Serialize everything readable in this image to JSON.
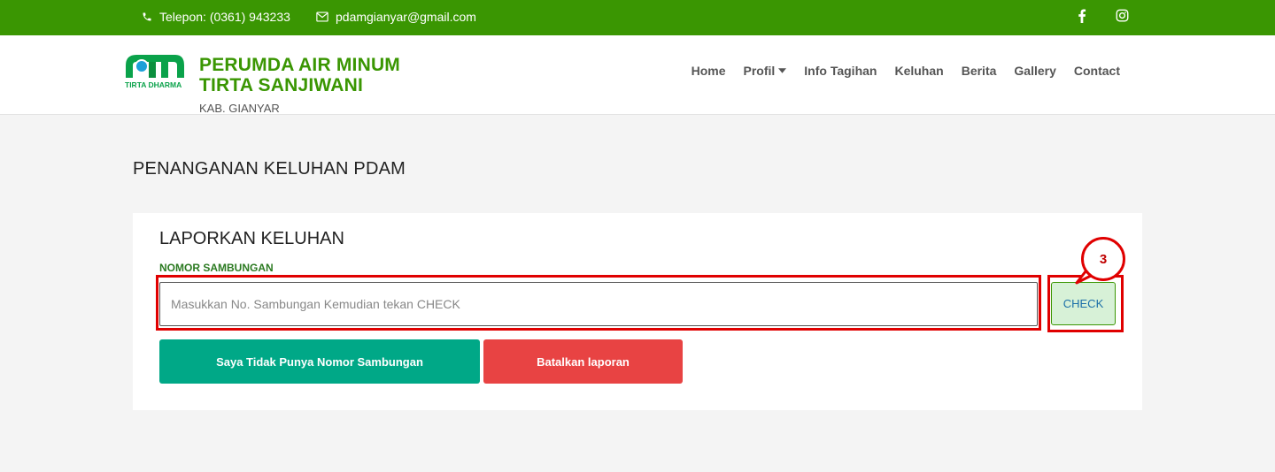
{
  "topbar": {
    "phone": "Telepon: (0361) 943233",
    "email": "pdamgianyar@gmail.com",
    "social": [
      "facebook-icon",
      "instagram-icon"
    ],
    "bg_color": "#3a9602"
  },
  "header": {
    "logo_text": "TIRTA DHARMA",
    "brand_line1": "PERUMDA AIR MINUM",
    "brand_line2": "TIRTA SANJIWANI",
    "brand_line3": "KAB. GIANYAR",
    "nav": {
      "home": "Home",
      "profil": "Profil",
      "info_tagihan": "Info Tagihan",
      "keluhan": "Keluhan",
      "berita": "Berita",
      "gallery": "Gallery",
      "contact": "Contact"
    }
  },
  "page": {
    "title": "PENANGANAN KELUHAN PDAM"
  },
  "form": {
    "title": "LAPORKAN KELUHAN",
    "field_label": "NOMOR SAMBUNGAN",
    "input_value": "",
    "input_placeholder": "Masukkan No. Sambungan Kemudian tekan CHECK",
    "check_label": "CHECK",
    "no_number_label": "Saya Tidak Punya Nomor Sambungan",
    "cancel_label": "Batalkan laporan"
  },
  "annotation": {
    "step_number": "3",
    "color": "#e00000"
  },
  "colors": {
    "accent_green": "#3a9602",
    "teal_button": "#00a887",
    "red_button": "#e84343",
    "check_bg": "#d7f1d7"
  }
}
